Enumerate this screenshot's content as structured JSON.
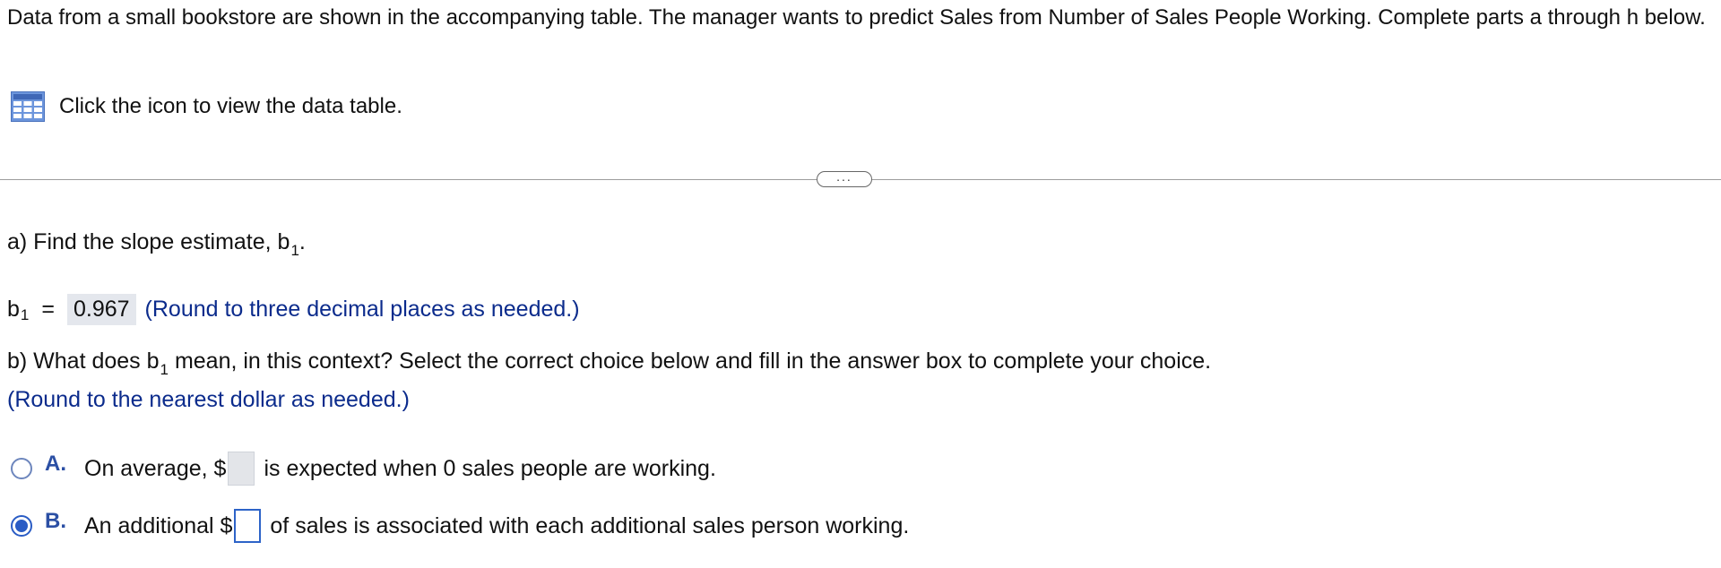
{
  "intro": {
    "text": "Data from a small bookstore are shown in the accompanying table. The manager wants to predict Sales from Number of Sales People Working. Complete parts a through h below."
  },
  "data_table_link": {
    "icon": "table-grid-icon",
    "label": "Click the icon to view the data table."
  },
  "divider": {
    "expand_label": "..."
  },
  "part_a": {
    "question_prefix": "a) Find the slope estimate, b",
    "question_sub": "1",
    "question_suffix": ".",
    "answer_var": "b",
    "answer_sub": "1",
    "equals": "=",
    "answer_value": "0.967",
    "hint": "(Round to three decimal places as needed.)"
  },
  "part_b": {
    "question_prefix": "b) What does b",
    "question_sub": "1",
    "question_suffix": " mean, in this context? Select the correct choice below and fill in the answer box to complete your choice.",
    "hint": "(Round to the nearest dollar as needed.)",
    "choices": [
      {
        "letter": "A.",
        "before": "On average, $",
        "after": "is expected when 0 sales people are working.",
        "selected": false,
        "value": ""
      },
      {
        "letter": "B.",
        "before": "An additional $",
        "after": "of sales is associated with each additional sales person working.",
        "selected": true,
        "value": ""
      }
    ]
  },
  "colors": {
    "hint_blue": "#0b2b8c",
    "radio_blue": "#2a5cc5",
    "divider_gray": "#9c9c9c"
  }
}
